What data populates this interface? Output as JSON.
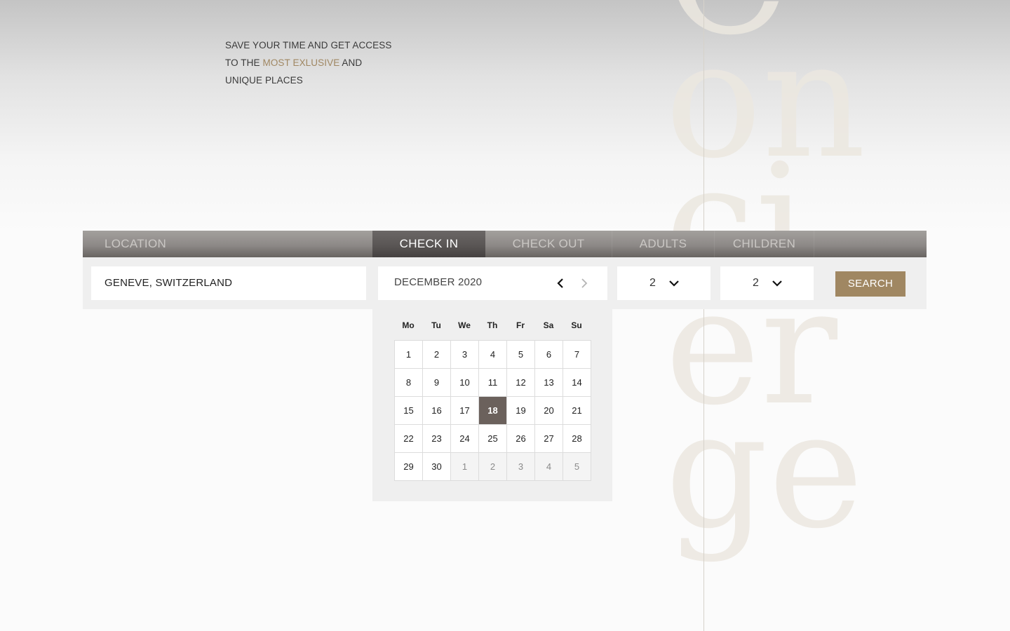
{
  "background_word": "Concierge",
  "tagline": {
    "line1": "SAVE YOUR TIME AND GET ACCESS",
    "line2_prefix": "TO THE ",
    "line2_accent": "MOST EXLUSIVE",
    "line2_suffix": " AND",
    "line3": "UNIQUE PLACES"
  },
  "tabs": {
    "location": "LOCATION",
    "check_in": "CHECK IN",
    "check_out": "CHECK OUT",
    "adults": "ADULTS",
    "children": "CHILDREN",
    "active": "check_in"
  },
  "search": {
    "location_value": "GENEVE, SWITZERLAND",
    "month_label": "DECEMBER  2020",
    "adults_value": "2",
    "children_value": "2",
    "button_label": "SEARCH"
  },
  "calendar": {
    "weekdays": [
      "Mo",
      "Tu",
      "We",
      "Th",
      "Fr",
      "Sa",
      "Su"
    ],
    "days": [
      {
        "label": "1"
      },
      {
        "label": "2"
      },
      {
        "label": "3"
      },
      {
        "label": "4"
      },
      {
        "label": "5"
      },
      {
        "label": "6"
      },
      {
        "label": "7"
      },
      {
        "label": "8"
      },
      {
        "label": "9"
      },
      {
        "label": "10"
      },
      {
        "label": "11"
      },
      {
        "label": "12"
      },
      {
        "label": "13"
      },
      {
        "label": "14"
      },
      {
        "label": "15"
      },
      {
        "label": "16"
      },
      {
        "label": "17"
      },
      {
        "label": "18",
        "selected": true
      },
      {
        "label": "19"
      },
      {
        "label": "20"
      },
      {
        "label": "21"
      },
      {
        "label": "22"
      },
      {
        "label": "23"
      },
      {
        "label": "24"
      },
      {
        "label": "25"
      },
      {
        "label": "26"
      },
      {
        "label": "27"
      },
      {
        "label": "28"
      },
      {
        "label": "29"
      },
      {
        "label": "30"
      },
      {
        "label": "1",
        "other_month": true
      },
      {
        "label": "2",
        "other_month": true
      },
      {
        "label": "3",
        "other_month": true
      },
      {
        "label": "4",
        "other_month": true
      },
      {
        "label": "5",
        "other_month": true
      }
    ]
  },
  "colors": {
    "accent": "#a08762",
    "selected_day": "#6b615c",
    "tab_bar": "#8d8987"
  },
  "icons": {
    "prev": "chevron-left-icon",
    "next": "chevron-right-icon",
    "dropdown": "chevron-down-icon"
  }
}
